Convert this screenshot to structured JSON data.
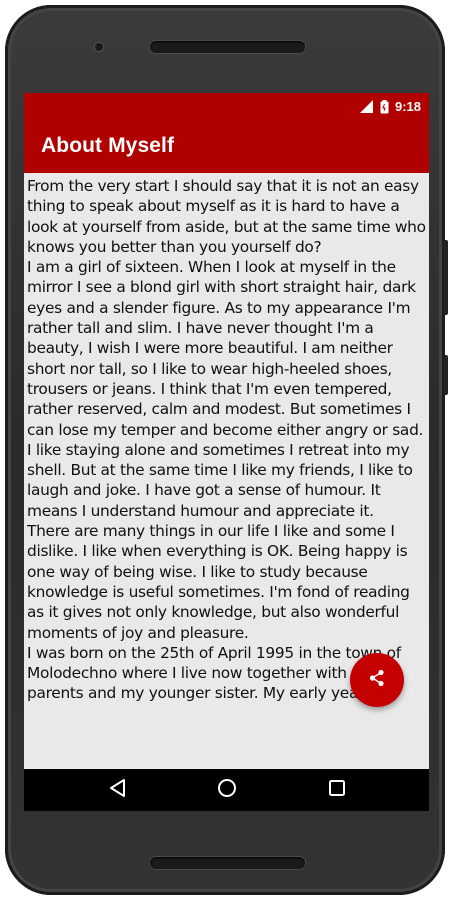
{
  "status_bar": {
    "time": "9:18",
    "icons": [
      "signal-icon",
      "battery-icon"
    ]
  },
  "app_bar": {
    "title": "About Myself"
  },
  "article": {
    "paragraphs": [
      "From the very start I should say that it is not an easy thing to speak about myself as it is hard to have a look at yourself from aside, but at the same time who knows you better than you yourself do?",
      "I am a girl of sixteen. When I look at myself in the mirror I see a blond girl with short straight hair, dark eyes and a slender figure. As to my appearance I'm rather tall and slim. I have never thought I'm a beauty, I wish I were more beautiful. I am neither short nor tall, so I like to wear high-heeled shoes, trousers or jeans. I think that I'm even tempered, rather reserved, calm and modest. But sometimes I can lose my temper and become either angry or sad. I like staying alone and sometimes I retreat into my shell. But at the same time I like my friends, I like to laugh and joke. I have got a sense of humour. It means I understand humour and appreciate it.",
      "There are many things in our life I like and some I dislike. I like when everything is OK. Being happy is one way of being wise. I like to study because knowledge is useful sometimes. I'm fond of reading as it gives not only knowledge, but also wonderful moments of joy and pleasure.",
      "I was born on the 25th of April 1995 in the town of Molodechno where I live now together with my parents and my younger sister. My early years"
    ]
  },
  "fab": {
    "icon": "share-icon"
  },
  "nav_bar": {
    "icons": [
      "back-icon",
      "home-icon",
      "recents-icon"
    ]
  },
  "colors": {
    "primary": "#b00000",
    "fab": "#c40000",
    "background": "#e9e9e9",
    "nav_bar": "#000000"
  }
}
